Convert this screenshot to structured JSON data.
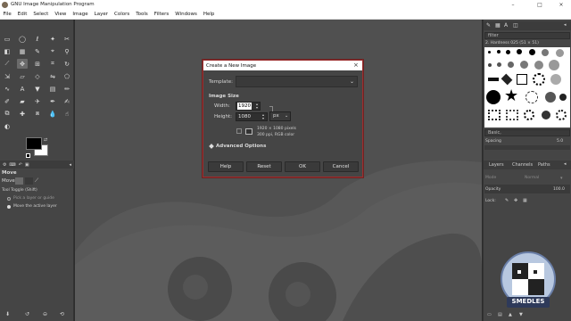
{
  "window": {
    "title": "GNU Image Manipulation Program",
    "controls": {
      "minimize": "–",
      "maximize": "□",
      "close": "×"
    }
  },
  "menubar": {
    "items": [
      "File",
      "Edit",
      "Select",
      "View",
      "Image",
      "Layer",
      "Colors",
      "Tools",
      "Filters",
      "Windows",
      "Help"
    ]
  },
  "toolbox": {
    "tool_options": {
      "title": "Move",
      "move_label": "Move:",
      "tool_toggle": "Tool Toggle  (Shift)",
      "option1": "Pick a layer or guide",
      "option2": "Move the active layer"
    }
  },
  "right_dock": {
    "filter_placeholder": "filter",
    "brush_name": "2. Hardness 025 (51 × 51)",
    "brush_preset": "Basic,",
    "spacing_label": "Spacing",
    "spacing_value": "5.0",
    "tabs": {
      "layers": "Layers",
      "channels": "Channels",
      "paths": "Paths"
    },
    "mode_label": "Mode",
    "mode_value": "Normal",
    "opacity_label": "Opacity",
    "opacity_value": "100.0",
    "lock_label": "Lock:"
  },
  "dialog": {
    "title": "Create a New Image",
    "template_label": "Template:",
    "image_size_heading": "Image Size",
    "width_label": "Width:",
    "width_value": "1920",
    "height_label": "Height:",
    "height_value": "1080",
    "unit": "px",
    "info_line1": "1920 × 1080 pixels",
    "info_line2": "300 ppi, RGB color",
    "advanced_options": "Advanced Options",
    "buttons": {
      "help": "Help",
      "reset": "Reset",
      "ok": "OK",
      "cancel": "Cancel"
    }
  },
  "watermark": {
    "text": "SMEDLES"
  },
  "colors": {
    "canvas_bg": "#505050",
    "dock_bg": "#454545",
    "dialog_border": "#9b2f2f"
  }
}
